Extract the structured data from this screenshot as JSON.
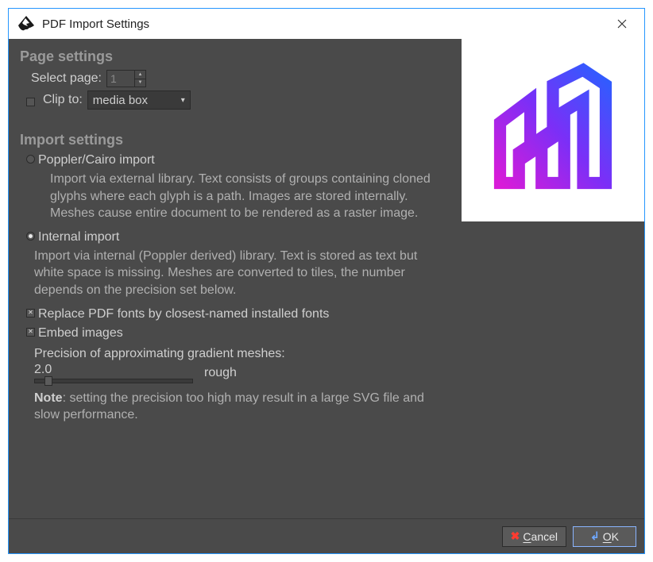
{
  "window": {
    "title": "PDF Import Settings"
  },
  "page_settings": {
    "heading": "Page settings",
    "select_page_label": "Select page:",
    "select_page_value": "1",
    "clip_to_label": "Clip to:",
    "clip_to_value": "media box"
  },
  "import_settings": {
    "heading": "Import settings",
    "poppler_label": "Poppler/Cairo import",
    "poppler_desc": "Import via external library. Text consists of groups containing cloned glyphs where each glyph is a path. Images are stored internally. Meshes cause entire document to be rendered as a raster image.",
    "internal_label": "Internal import",
    "internal_desc": "Import via internal (Poppler derived) library. Text is stored as text but white space is missing. Meshes are converted to tiles, the number depends on the precision set below.",
    "replace_fonts_label": "Replace PDF fonts by closest-named installed fonts",
    "embed_images_label": "Embed images",
    "precision_label": "Precision of approximating gradient meshes:",
    "precision_value": "2.0",
    "precision_hint": "rough",
    "note_prefix": "Note",
    "note_text": ": setting the precision too high may result in a large SVG file and slow performance."
  },
  "buttons": {
    "cancel": "Cancel",
    "ok": "OK"
  }
}
